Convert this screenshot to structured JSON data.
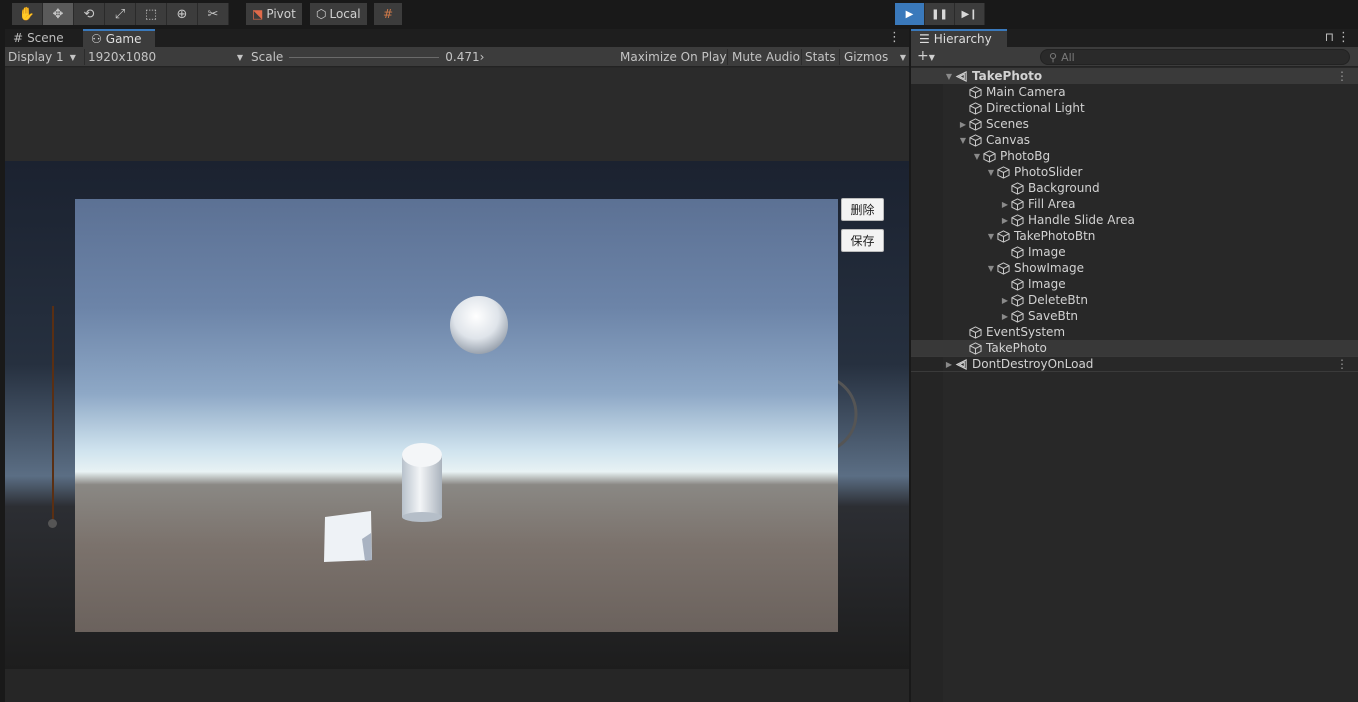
{
  "toolbar": {
    "pivot_label": "Pivot",
    "local_label": "Local"
  },
  "game_panel": {
    "tabs": [
      "Scene",
      "Game"
    ],
    "display": "Display 1",
    "resolution": "1920x1080",
    "scale_label": "Scale",
    "scale_value": "0.471›",
    "maximize": "Maximize On Play",
    "mute": "Mute Audio",
    "stats": "Stats",
    "gizmos": "Gizmos"
  },
  "game_view": {
    "delete_label": "删除",
    "save_label": "保存"
  },
  "hierarchy": {
    "tab": "Hierarchy",
    "search_placeholder": "All",
    "items": [
      {
        "label": "TakePhoto"
      },
      {
        "label": "Main Camera"
      },
      {
        "label": "Directional Light"
      },
      {
        "label": "Scenes"
      },
      {
        "label": "Canvas"
      },
      {
        "label": "PhotoBg"
      },
      {
        "label": "PhotoSlider"
      },
      {
        "label": "Background"
      },
      {
        "label": "Fill Area"
      },
      {
        "label": "Handle Slide Area"
      },
      {
        "label": "TakePhotoBtn"
      },
      {
        "label": "Image"
      },
      {
        "label": "ShowImage"
      },
      {
        "label": "Image"
      },
      {
        "label": "DeleteBtn"
      },
      {
        "label": "SaveBtn"
      },
      {
        "label": "EventSystem"
      },
      {
        "label": "TakePhoto"
      },
      {
        "label": "DontDestroyOnLoad"
      }
    ]
  }
}
